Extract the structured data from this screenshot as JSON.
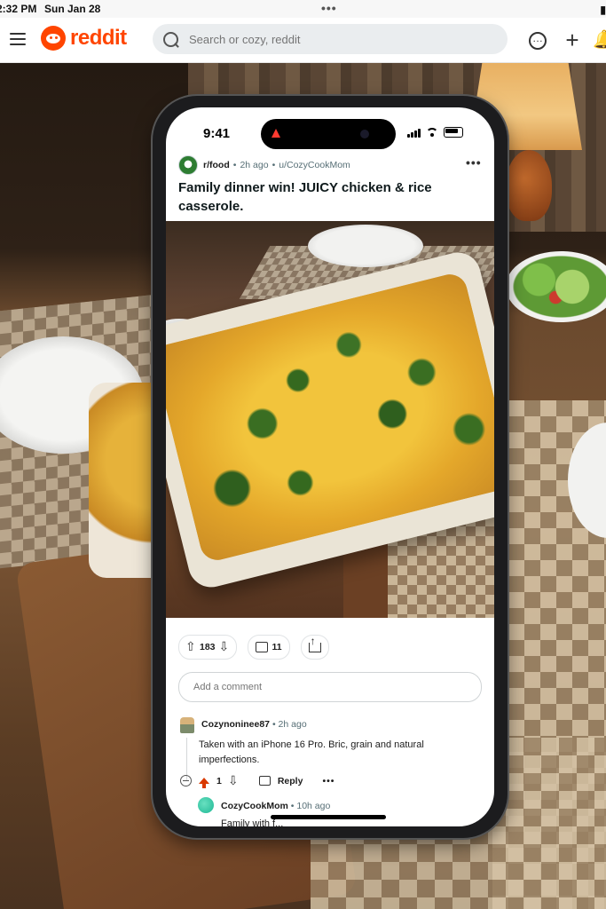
{
  "ipad_status": {
    "time": "2:32 PM",
    "date": "Sun Jan 28"
  },
  "reddit": {
    "logo_text": "reddit",
    "search_placeholder": "Search or cozy, reddit"
  },
  "phone": {
    "status_time": "9:41"
  },
  "post": {
    "subreddit": "r/food",
    "age": "2h ago",
    "author": "u/CozyCookMom",
    "title": "Family dinner win! JUICY chicken & rice casserole.",
    "votes": "183",
    "comments": "11"
  },
  "add_comment_placeholder": "Add a comment",
  "comments": [
    {
      "user": "Cozynoninee87",
      "age": "2h ago",
      "body": "Taken with an iPhone 16 Pro. Bric, grain and natural imperfections.",
      "votes": "1",
      "reply_label": "Reply"
    },
    {
      "user": "CozyCookMom",
      "age": "10h ago",
      "body": "Family with f..."
    }
  ],
  "colors": {
    "reddit_orange": "#ff4500",
    "upvote_red": "#d93900"
  }
}
